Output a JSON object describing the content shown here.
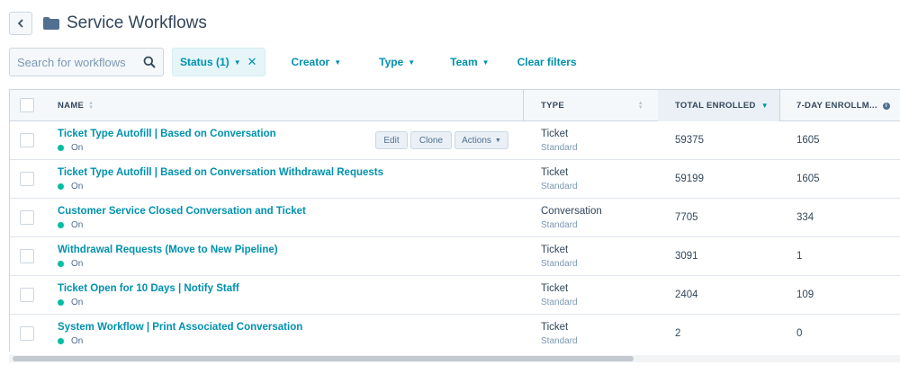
{
  "header": {
    "title": "Service Workflows"
  },
  "filters": {
    "search_placeholder": "Search for workflows",
    "status_label": "Status (1)",
    "creator_label": "Creator",
    "type_label": "Type",
    "team_label": "Team",
    "clear_label": "Clear filters"
  },
  "table": {
    "columns": {
      "name": "NAME",
      "type": "TYPE",
      "total_enrolled": "TOTAL ENROLLED",
      "seven_day": "7-DAY ENROLLM..."
    },
    "row_actions": {
      "edit": "Edit",
      "clone": "Clone",
      "actions": "Actions"
    },
    "rows": [
      {
        "name": "Ticket Type Autofill | Based on Conversation",
        "status": "On",
        "type": "Ticket",
        "subtype": "Standard",
        "total": "59375",
        "seven_day": "1605"
      },
      {
        "name": "Ticket Type Autofill | Based on Conversation Withdrawal Requests",
        "status": "On",
        "type": "Ticket",
        "subtype": "Standard",
        "total": "59199",
        "seven_day": "1605"
      },
      {
        "name": "Customer Service Closed Conversation and Ticket",
        "status": "On",
        "type": "Conversation",
        "subtype": "Standard",
        "total": "7705",
        "seven_day": "334"
      },
      {
        "name": "Withdrawal Requests (Move to New Pipeline)",
        "status": "On",
        "type": "Ticket",
        "subtype": "Standard",
        "total": "3091",
        "seven_day": "1"
      },
      {
        "name": "Ticket Open for 10 Days | Notify Staff",
        "status": "On",
        "type": "Ticket",
        "subtype": "Standard",
        "total": "2404",
        "seven_day": "109"
      },
      {
        "name": "System Workflow | Print Associated Conversation",
        "status": "On",
        "type": "Ticket",
        "subtype": "Standard",
        "total": "2",
        "seven_day": "0"
      }
    ]
  },
  "colors": {
    "accent": "#0091ae",
    "status_on": "#00bda5",
    "text": "#33475b"
  }
}
